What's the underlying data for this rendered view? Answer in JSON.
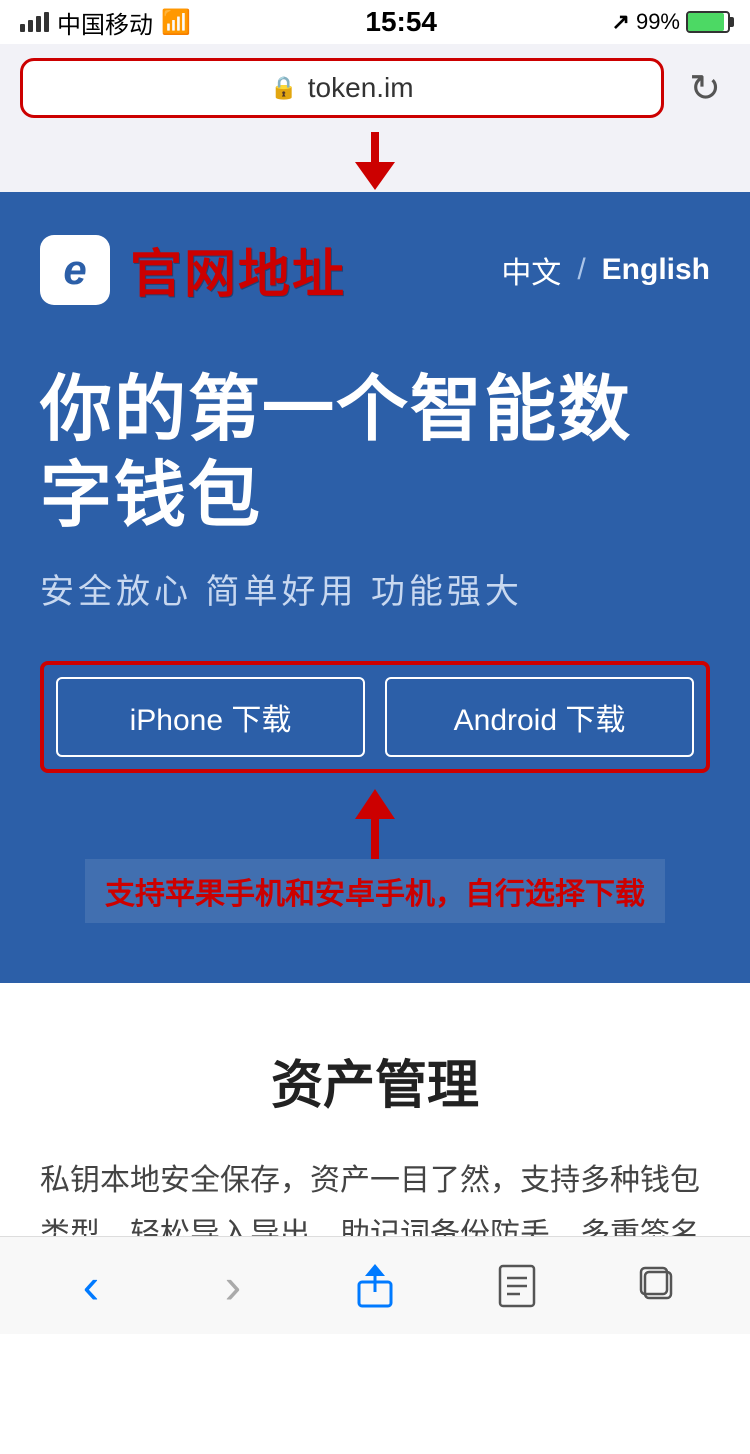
{
  "statusBar": {
    "carrier": "中国移动",
    "time": "15:54",
    "battery": "99%",
    "batteryFull": true,
    "locationArrow": true
  },
  "browserBar": {
    "url": "token.im",
    "reloadIcon": "↻"
  },
  "hero": {
    "logoChar": "e",
    "siteTitle": "官网地址",
    "lang": {
      "zh": "中文",
      "divider": "/",
      "en": "English"
    },
    "mainTitle": "你的第一个智能数\n字钱包",
    "subtitle": "安全放心  简单好用  功能强大",
    "iphoneBtn": "iPhone 下载",
    "androidBtn": "Android 下载"
  },
  "annotation": {
    "text": "支持苹果手机和安卓手机，自行选择下载"
  },
  "whitSection": {
    "title": "资产管理",
    "body": "私钥本地安全保存，资产一目了然，支持多种钱包类型，轻松导入导出，助记词备份防丢，多重签名防盗"
  },
  "bottomNav": {
    "back": "‹",
    "forward": "›",
    "share": "↑",
    "bookmarks": "⊞",
    "tabs": "⧉"
  }
}
